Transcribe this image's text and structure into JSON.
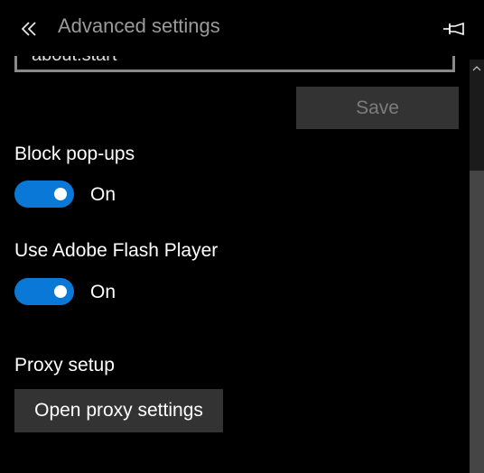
{
  "header": {
    "title": "Advanced settings",
    "back_icon": "double-chevron-left-icon",
    "pin_icon": "pin-icon"
  },
  "homepage_field": {
    "value": "about:start"
  },
  "save_button": {
    "label": "Save"
  },
  "block_popups": {
    "label": "Block pop-ups",
    "state": "On",
    "enabled": true
  },
  "flash_player": {
    "label": "Use Adobe Flash Player",
    "state": "On",
    "enabled": true
  },
  "proxy": {
    "label": "Proxy setup",
    "button_label": "Open proxy settings"
  },
  "colors": {
    "accent": "#0a78d7",
    "background": "#000000",
    "button": "#333333"
  }
}
